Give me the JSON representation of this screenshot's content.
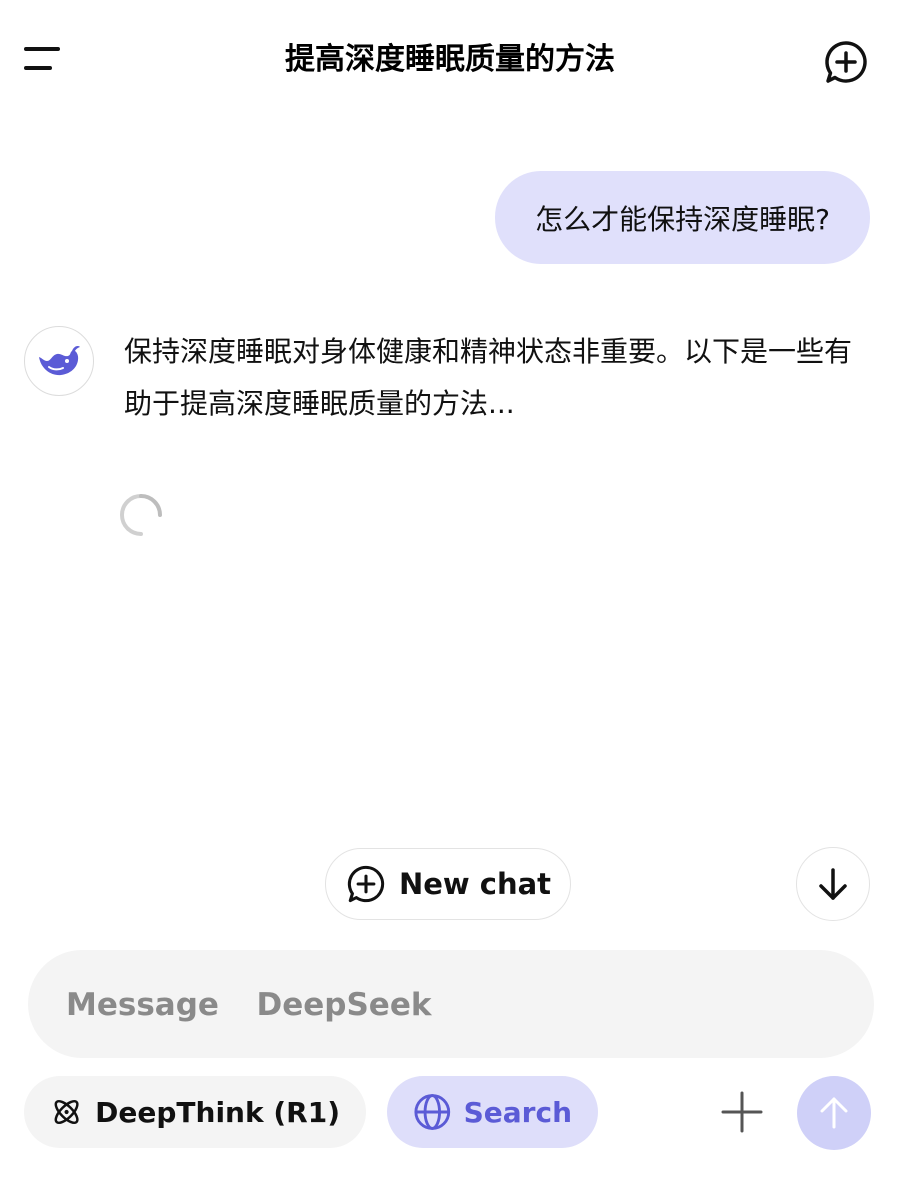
{
  "header": {
    "title": "提高深度睡眠质量的方法",
    "menu_icon": "menu-icon",
    "new_chat_icon": "chat-plus-icon"
  },
  "conversation": {
    "user_message": "怎么才能保持深度睡眠?",
    "assistant_reply": "保持深度睡眠对身体健康和精神状态非重要。以下是一些有助于提高深度睡眠质量的方法..."
  },
  "floating": {
    "new_chat_label": "New chat",
    "scroll_icon": "arrow-down-icon"
  },
  "composer": {
    "placeholder": "Message  DeepSeek",
    "value": ""
  },
  "toolbar": {
    "deepthink_label": "DeepThink (R1)",
    "search_label": "Search",
    "attach_icon": "plus-icon",
    "send_icon": "arrow-up-icon"
  },
  "colors": {
    "user_bubble": "#e0e0fb",
    "accent": "#5b5bd6",
    "search_pill": "#dedefa",
    "send_disabled": "#cfd0f8",
    "input_bg": "#f4f4f4"
  }
}
